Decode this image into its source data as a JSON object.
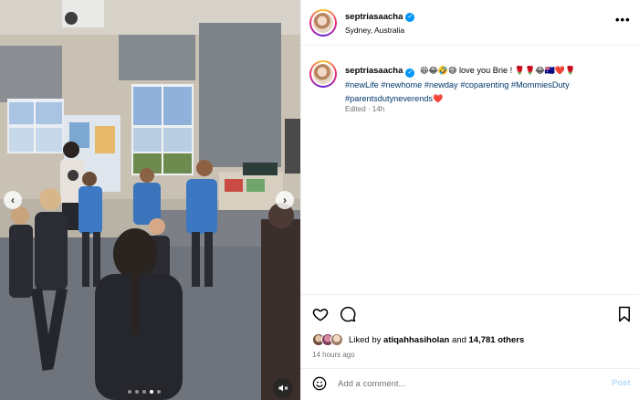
{
  "post": {
    "username": "septriasaacha",
    "location": "Sydney, Australia",
    "more_label": "•••"
  },
  "caption": {
    "username": "septriasaacha",
    "emojis_start": "😆😂🤣😅",
    "text": "love you Brie !",
    "emojis_end": "🌹🌹😂🇦🇺❤️🌹",
    "hashtags": [
      "#newLife",
      "#newhome",
      "#newday",
      "#coparenting",
      "#MommiesDuty",
      "#parentsdutyneverends"
    ],
    "trailing_emoji": "❤️",
    "meta": "Edited · 14h"
  },
  "media": {
    "prev_label": "‹",
    "next_label": "›",
    "slide_count": 5,
    "active_slide": 3
  },
  "actions": {
    "liked_by_prefix": "Liked by",
    "liked_by_user": "atiqahhasiholan",
    "liked_by_and": "and",
    "others_count": "14,781 others",
    "timestamp": "14 hours ago"
  },
  "comment_box": {
    "placeholder": "Add a comment...",
    "post_label": "Post"
  },
  "colors": {
    "hashtag": "#00376b",
    "verified": "#0095f6",
    "post_button": "#b3dbff",
    "muted_text": "#737373"
  },
  "icons": {
    "like": "heart-outline",
    "comment": "speech-bubble",
    "save": "bookmark",
    "emoji": "smiley",
    "mute": "speaker-muted",
    "more": "ellipsis"
  }
}
